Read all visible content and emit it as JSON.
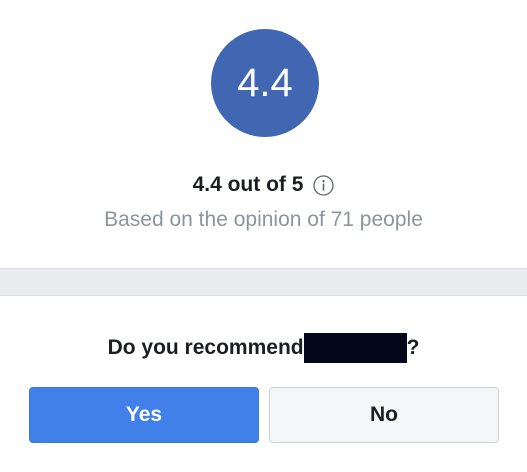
{
  "rating": {
    "score": "4.4",
    "summary": "4.4 out of 5",
    "based_on": "Based on the opinion of 71 people",
    "info_icon": "info-circle-icon"
  },
  "recommend": {
    "question_prefix": "Do you recommend",
    "question_suffix": "?",
    "yes_label": "Yes",
    "no_label": "No"
  },
  "colors": {
    "accent": "#4267b2",
    "yes_button": "#4080e8"
  }
}
